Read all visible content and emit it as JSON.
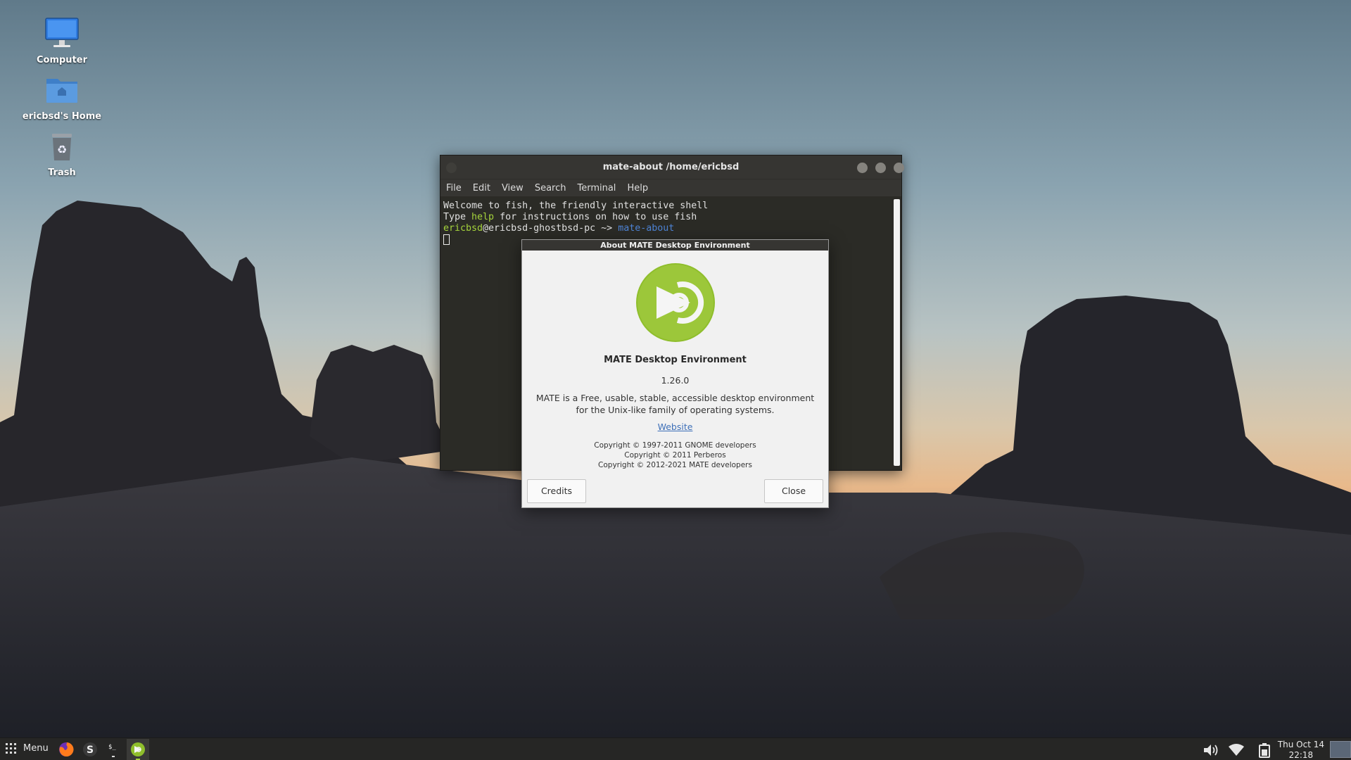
{
  "desktop": {
    "icons": [
      {
        "label": "Computer",
        "icon": "computer-icon"
      },
      {
        "label": "ericbsd's Home",
        "icon": "home-folder-icon"
      },
      {
        "label": "Trash",
        "icon": "trash-icon"
      }
    ]
  },
  "terminal": {
    "title": "mate-about /home/ericbsd",
    "menu": [
      "File",
      "Edit",
      "View",
      "Search",
      "Terminal",
      "Help"
    ],
    "lines": {
      "welcome": "Welcome to fish, the friendly interactive shell",
      "help_prefix": "Type ",
      "help_word": "help",
      "help_suffix": " for instructions on how to use fish",
      "prompt_user": "ericbsd",
      "prompt_host": "@ericbsd-ghostbsd-pc ~> ",
      "prompt_command": "mate-about"
    }
  },
  "about_dialog": {
    "title": "About MATE Desktop Environment",
    "app_name": "MATE Desktop Environment",
    "version": "1.26.0",
    "description": "MATE is a Free, usable, stable, accessible desktop environment for the Unix-like family of operating systems.",
    "website_label": "Website",
    "copyrights": [
      "Copyright © 1997-2011 GNOME developers",
      "Copyright © 2011 Perberos",
      "Copyright © 2012-2021 MATE developers"
    ],
    "credits_label": "Credits",
    "close_label": "Close",
    "logo": "mate-logo-icon",
    "logo_color": "#8fbe2c"
  },
  "taskbar": {
    "menu_label": "Menu",
    "launchers": [
      "firefox-icon",
      "software-station-icon",
      "terminal-icon",
      "mate-about-icon"
    ],
    "tray": [
      "volume-icon",
      "wifi-icon",
      "battery-icon"
    ],
    "clock_date": "Thu Oct 14",
    "clock_time": "22:18"
  },
  "colors": {
    "accent_green": "#a5d33c",
    "prompt_blue": "#4e84d6",
    "panel": "#262625"
  }
}
